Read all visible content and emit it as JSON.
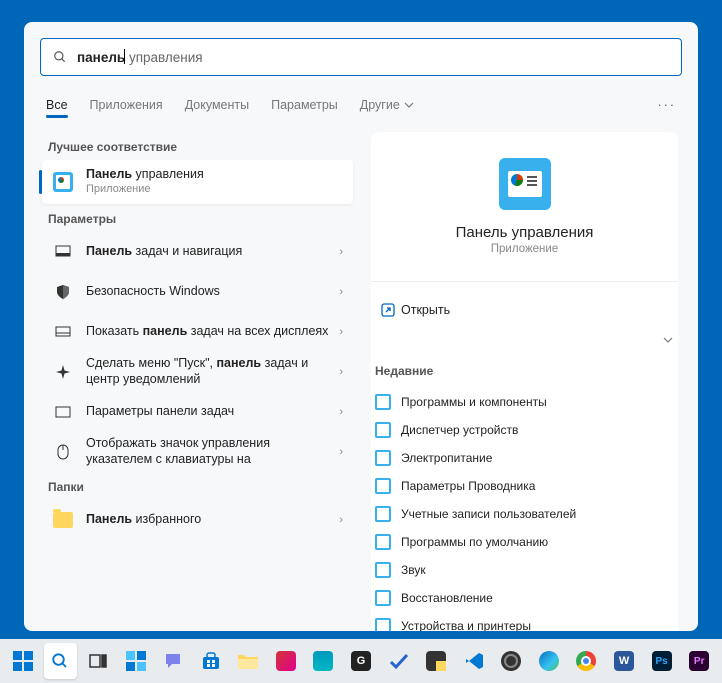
{
  "search": {
    "typed": "панель",
    "completion": " управления"
  },
  "tabs": [
    "Все",
    "Приложения",
    "Документы",
    "Параметры",
    "Другие"
  ],
  "best_match_title": "Лучшее соответствие",
  "best_match": {
    "name_bold": "Панель",
    "name_rest": " управления",
    "sub": "Приложение"
  },
  "settings_title": "Параметры",
  "settings": [
    {
      "pre": "",
      "bold": "Панель",
      "post": " задач и навигация",
      "icon": "taskbar"
    },
    {
      "pre": "Безопасность Windows",
      "bold": "",
      "post": "",
      "icon": "shield"
    },
    {
      "pre": "Показать ",
      "bold": "панель",
      "post": " задач на всех дисплеях",
      "icon": "monitor"
    },
    {
      "pre": "Сделать меню \"Пуск\", ",
      "bold": "панель",
      "post": " задач и центр уведомлений",
      "icon": "sparkle"
    },
    {
      "pre": "Параметры панели задач",
      "bold": "",
      "post": "",
      "icon": "rect"
    },
    {
      "pre": "Отображать значок управления указателем с клавиатуры на",
      "bold": "",
      "post": "",
      "icon": "mouse"
    }
  ],
  "folders_title": "Папки",
  "folders": [
    {
      "pre": "",
      "bold": "Панель",
      "post": " избранного"
    }
  ],
  "detail": {
    "title": "Панель управления",
    "sub": "Приложение",
    "open": "Открыть",
    "recent_title": "Недавние",
    "recent": [
      "Программы и компоненты",
      "Диспетчер устройств",
      "Электропитание",
      "Параметры Проводника",
      "Учетные записи пользователей",
      "Программы по умолчанию",
      "Звук",
      "Восстановление",
      "Устройства и принтеры"
    ]
  },
  "taskbar_apps": [
    "start",
    "search",
    "taskview",
    "widgets",
    "chat",
    "store",
    "explorer",
    "settings",
    "edge-2",
    "gear-g",
    "todo",
    "notes",
    "vscode",
    "obs",
    "edge",
    "chrome",
    "word",
    "photoshop",
    "premiere"
  ]
}
